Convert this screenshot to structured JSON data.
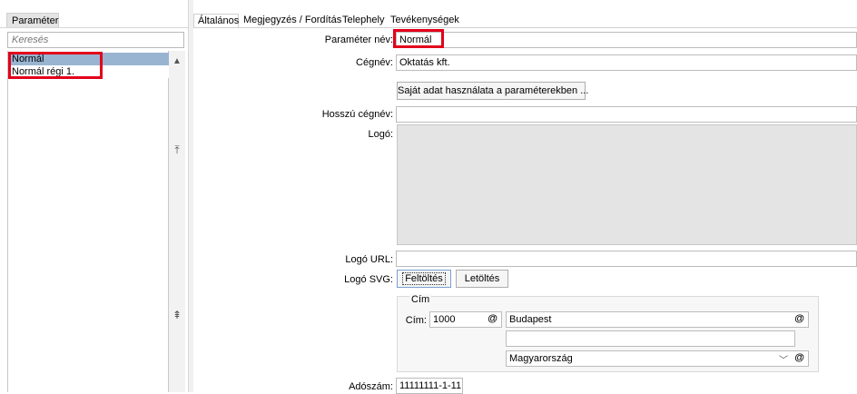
{
  "left": {
    "tab_label": "Paraméter",
    "search_placeholder": "Keresés",
    "items": [
      {
        "label": "Normál"
      },
      {
        "label": "Normál régi 1."
      }
    ]
  },
  "tabs": [
    {
      "label": "Általános"
    },
    {
      "label": "Megjegyzés / Fordítás"
    },
    {
      "label": "Telephely"
    },
    {
      "label": "Tevékenységek"
    }
  ],
  "form": {
    "param_label": "Paraméter név:",
    "param_value": "Normál",
    "cegnev_label": "Cégnév:",
    "cegnev_value": "Oktatás kft.",
    "sajat_button": "Saját adat használata a paraméterekben ...",
    "hosszu_label": "Hosszú cégnév:",
    "hosszu_value": "",
    "logo_label": "Logó:",
    "logourl_label": "Logó URL:",
    "logourl_value": "",
    "logosvg_label": "Logó SVG:",
    "feltoltes_button": "Feltöltés",
    "letoltes_button": "Letöltés",
    "cim_group_title": "Cím",
    "cim_label": "Cím:",
    "irsz_value": "1000",
    "varos_value": "Budapest",
    "extra_value": "",
    "orszag_value": "Magyarország",
    "adoszam_label": "Adószám:",
    "adoszam_value": "11111111-1-11"
  },
  "colors": {
    "selection": "#99b4d1",
    "highlight_box": "#e2001a"
  }
}
